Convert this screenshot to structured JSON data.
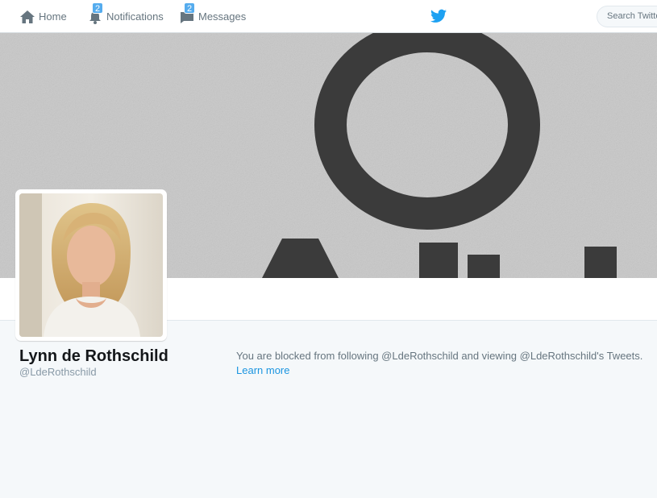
{
  "nav": {
    "home_label": "Home",
    "notifications_label": "Notifications",
    "notifications_badge": "2",
    "messages_label": "Messages",
    "messages_badge": "2"
  },
  "search": {
    "placeholder": "Search Twitter"
  },
  "profile": {
    "name": "Lynn de Rothschild",
    "handle": "@LdeRothschild"
  },
  "blocked": {
    "message": "You are blocked from following @LdeRothschild and viewing @LdeRothschild's Tweets.",
    "link": "Learn more"
  },
  "icons": {
    "home": "home-icon",
    "notifications": "bell-icon",
    "messages": "envelope-icon",
    "brand": "twitter-bird-icon"
  },
  "colors": {
    "accent": "#1da1f2",
    "link": "#1b95e0",
    "badge": "#55acee",
    "page_background": "#f5f8fa"
  }
}
